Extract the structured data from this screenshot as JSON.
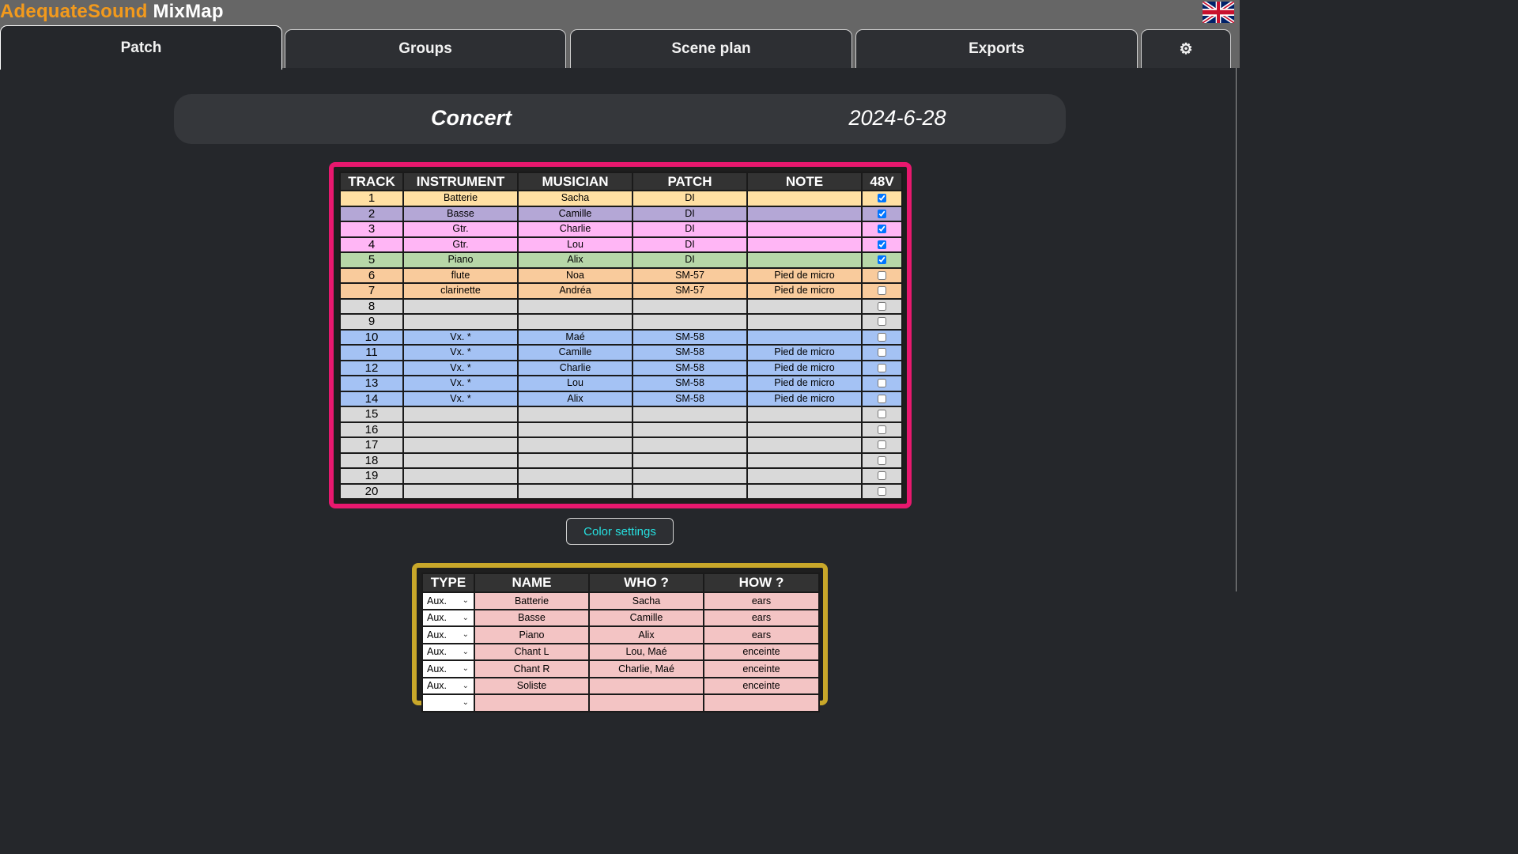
{
  "app": {
    "brand": "AdequateSound",
    "name": "MixMap",
    "language_flag": "uk-flag-icon"
  },
  "tabs": [
    {
      "label": "Patch",
      "active": true
    },
    {
      "label": "Groups",
      "active": false
    },
    {
      "label": "Scene plan",
      "active": false
    },
    {
      "label": "Exports",
      "active": false
    },
    {
      "label": "⚙",
      "icon": "gear-icon",
      "active": false
    }
  ],
  "event": {
    "title": "Concert",
    "date": "2024-6-28"
  },
  "patch": {
    "headers": [
      "TRACK",
      "INSTRUMENT",
      "MUSICIAN",
      "PATCH",
      "NOTE",
      "48V"
    ],
    "rows": [
      {
        "track": "1",
        "instrument": "Batterie",
        "musician": "Sacha",
        "patch": "DI",
        "note": "",
        "phantom": true,
        "color": "#ffe0a3"
      },
      {
        "track": "2",
        "instrument": "Basse",
        "musician": "Camille",
        "patch": "DI",
        "note": "",
        "phantom": true,
        "color": "#b4a7d6"
      },
      {
        "track": "3",
        "instrument": "Gtr.",
        "musician": "Charlie",
        "patch": "DI",
        "note": "",
        "phantom": true,
        "color": "#ffb6f5"
      },
      {
        "track": "4",
        "instrument": "Gtr.",
        "musician": "Lou",
        "patch": "DI",
        "note": "",
        "phantom": true,
        "color": "#ffb6f5"
      },
      {
        "track": "5",
        "instrument": "Piano",
        "musician": "Alix",
        "patch": "DI",
        "note": "",
        "phantom": true,
        "color": "#b7d7a8"
      },
      {
        "track": "6",
        "instrument": "flute",
        "musician": "Noa",
        "patch": "SM-57",
        "note": "Pied de micro",
        "phantom": false,
        "color": "#f9cb9c"
      },
      {
        "track": "7",
        "instrument": "clarinette",
        "musician": "Andréa",
        "patch": "SM-57",
        "note": "Pied de micro",
        "phantom": false,
        "color": "#f9cb9c"
      },
      {
        "track": "8",
        "instrument": "",
        "musician": "",
        "patch": "",
        "note": "",
        "phantom": false,
        "color": "#d9d9d9"
      },
      {
        "track": "9",
        "instrument": "",
        "musician": "",
        "patch": "",
        "note": "",
        "phantom": false,
        "color": "#d9d9d9"
      },
      {
        "track": "10",
        "instrument": "Vx. *",
        "musician": "Maé",
        "patch": "SM-58",
        "note": "",
        "phantom": false,
        "color": "#a4c2f4"
      },
      {
        "track": "11",
        "instrument": "Vx. *",
        "musician": "Camille",
        "patch": "SM-58",
        "note": "Pied de micro",
        "phantom": false,
        "color": "#a4c2f4"
      },
      {
        "track": "12",
        "instrument": "Vx. *",
        "musician": "Charlie",
        "patch": "SM-58",
        "note": "Pied de micro",
        "phantom": false,
        "color": "#a4c2f4"
      },
      {
        "track": "13",
        "instrument": "Vx. *",
        "musician": "Lou",
        "patch": "SM-58",
        "note": "Pied de micro",
        "phantom": false,
        "color": "#a4c2f4"
      },
      {
        "track": "14",
        "instrument": "Vx. *",
        "musician": "Alix",
        "patch": "SM-58",
        "note": "Pied de micro",
        "phantom": false,
        "color": "#a4c2f4"
      },
      {
        "track": "15",
        "instrument": "",
        "musician": "",
        "patch": "",
        "note": "",
        "phantom": false,
        "color": "#d9d9d9"
      },
      {
        "track": "16",
        "instrument": "",
        "musician": "",
        "patch": "",
        "note": "",
        "phantom": false,
        "color": "#d9d9d9"
      },
      {
        "track": "17",
        "instrument": "",
        "musician": "",
        "patch": "",
        "note": "",
        "phantom": false,
        "color": "#d9d9d9"
      },
      {
        "track": "18",
        "instrument": "",
        "musician": "",
        "patch": "",
        "note": "",
        "phantom": false,
        "color": "#d9d9d9"
      },
      {
        "track": "19",
        "instrument": "",
        "musician": "",
        "patch": "",
        "note": "",
        "phantom": false,
        "color": "#d9d9d9"
      },
      {
        "track": "20",
        "instrument": "",
        "musician": "",
        "patch": "",
        "note": "",
        "phantom": false,
        "color": "#d9d9d9"
      }
    ]
  },
  "color_settings_label": "Color settings",
  "groups": {
    "headers": [
      "TYPE",
      "NAME",
      "WHO ?",
      "HOW ?"
    ],
    "rows": [
      {
        "type": "Aux.",
        "name": "Batterie",
        "who": "Sacha",
        "how": "ears"
      },
      {
        "type": "Aux.",
        "name": "Basse",
        "who": "Camille",
        "how": "ears"
      },
      {
        "type": "Aux.",
        "name": "Piano",
        "who": "Alix",
        "how": "ears"
      },
      {
        "type": "Aux.",
        "name": "Chant L",
        "who": "Lou, Maé",
        "how": "enceinte"
      },
      {
        "type": "Aux.",
        "name": "Chant R",
        "who": "Charlie, Maé",
        "how": "enceinte"
      },
      {
        "type": "Aux.",
        "name": "Soliste",
        "who": "",
        "how": "enceinte"
      },
      {
        "type": "",
        "name": "",
        "who": "",
        "how": ""
      }
    ]
  },
  "colors": {
    "patch_frame": "#e8186e",
    "groups_frame": "#c8a72a",
    "accent_text": "#26e0e0",
    "brand": "#f39a1c"
  }
}
